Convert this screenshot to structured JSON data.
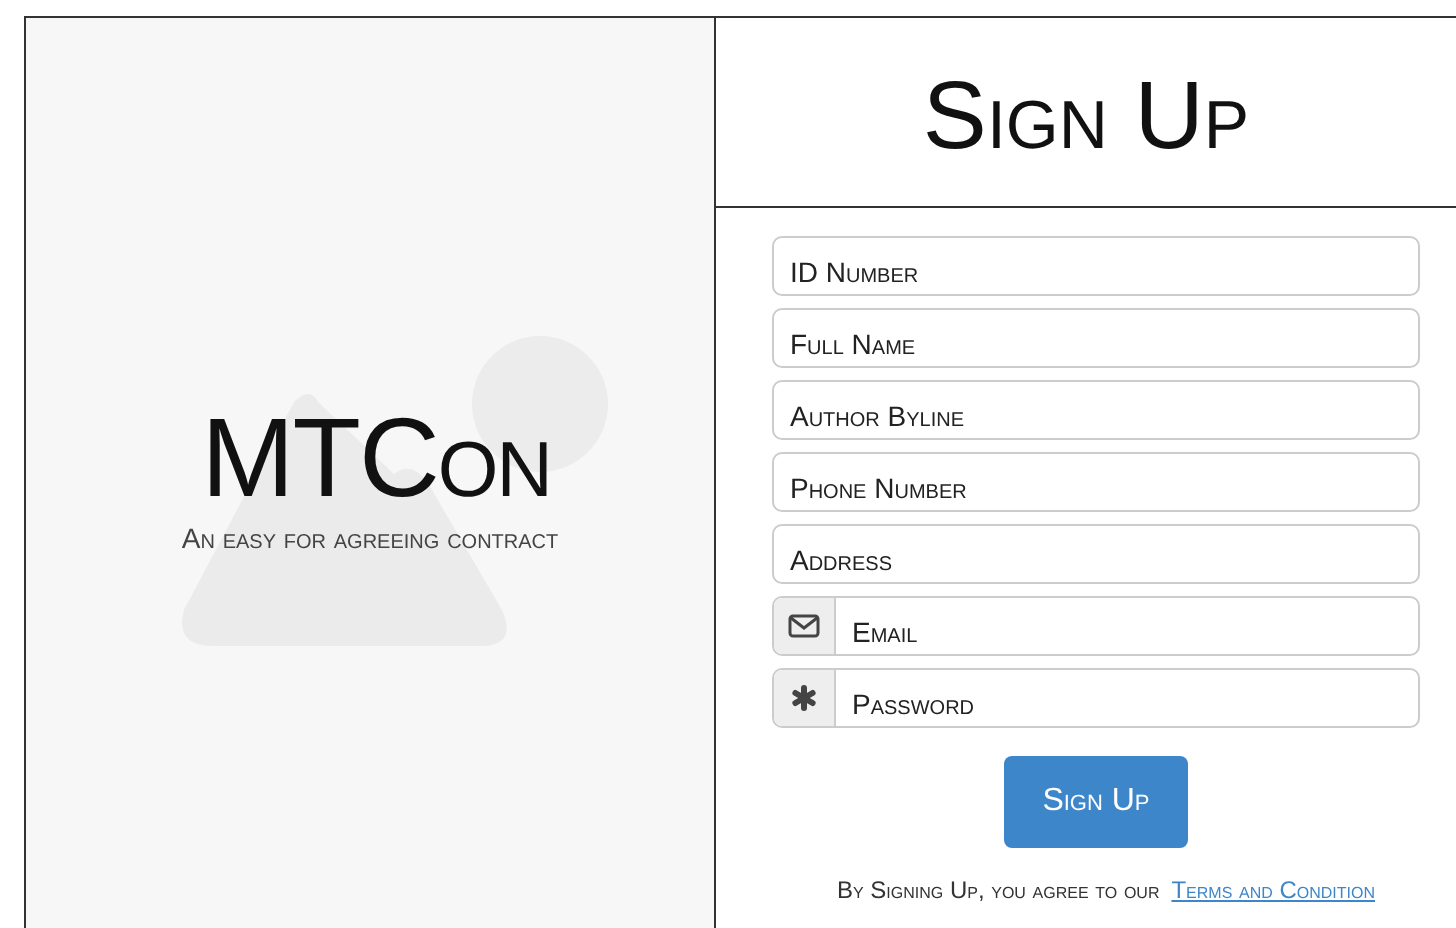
{
  "brand": {
    "title": "MTCon",
    "tagline": "An easy for agreeing contract"
  },
  "form": {
    "title": "Sign Up",
    "fields": [
      {
        "kind": "plain",
        "placeholder": "ID Number"
      },
      {
        "kind": "plain",
        "placeholder": "Full Name"
      },
      {
        "kind": "plain",
        "placeholder": "Author Byline"
      },
      {
        "kind": "plain",
        "placeholder": "Phone Number"
      },
      {
        "kind": "plain",
        "placeholder": "Address"
      },
      {
        "kind": "email",
        "placeholder": "Email"
      },
      {
        "kind": "password",
        "placeholder": "Password"
      }
    ],
    "submit": "Sign Up",
    "agreement": "By Signing Up, you agree to our",
    "terms_link": "Terms and Condition"
  }
}
